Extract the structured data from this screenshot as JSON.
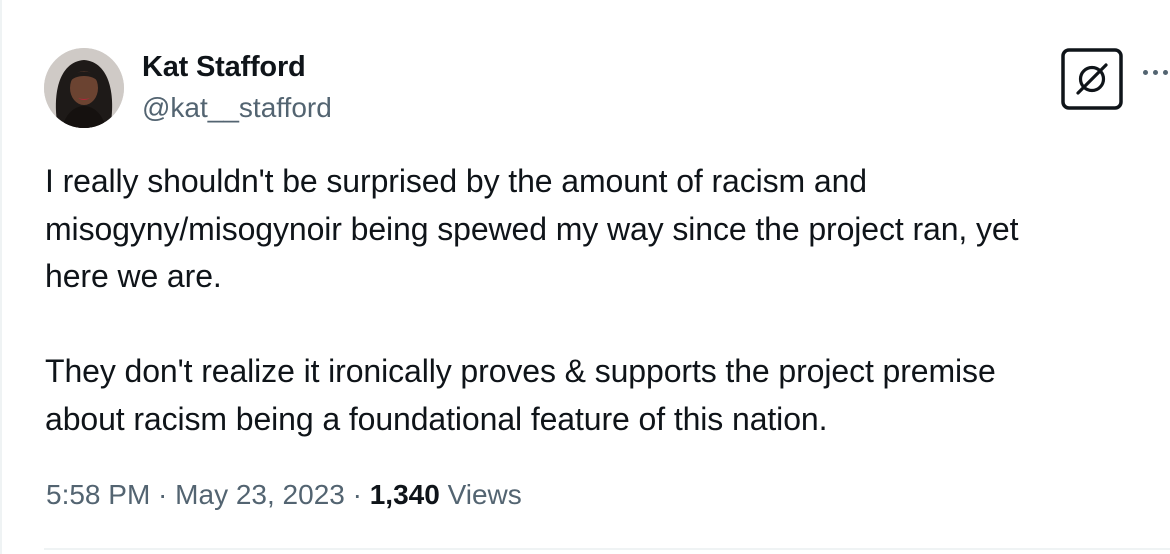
{
  "author": {
    "display_name": "Kat Stafford",
    "handle": "@kat__stafford"
  },
  "tweet": {
    "paragraphs": [
      "I really shouldn't be surprised by the amount of racism and\nmisogyny/misogynoir being spewed my way since the project ran, yet\nhere we are.",
      "They don't realize it ironically proves & supports the project premise\nabout racism being a foundational feature of this nation."
    ]
  },
  "meta": {
    "time": "5:58 PM",
    "separator": " · ",
    "date": "May 23, 2023",
    "views_count": "1,340",
    "views_label": "Views"
  },
  "icons": {
    "grok": "grok-icon",
    "more": "more-icon"
  },
  "colors": {
    "text_primary": "#0f1419",
    "text_secondary": "#536471",
    "divider": "#eff3f4"
  }
}
